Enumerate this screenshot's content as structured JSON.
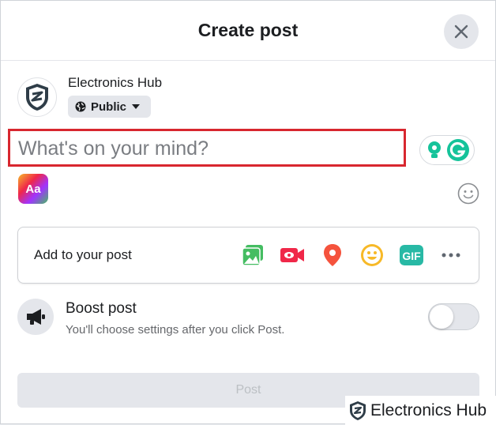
{
  "header": {
    "title": "Create post",
    "close_icon": "close-icon"
  },
  "profile": {
    "name": "Electronics Hub",
    "privacy": "Public",
    "privacy_icon": "globe-icon"
  },
  "composer": {
    "placeholder": "What's on your mind?",
    "value": "",
    "highlight_color": "#d8272f"
  },
  "extras": {
    "background_button": "Aa",
    "emoji_icon": "smiley-icon"
  },
  "add_to_post": {
    "label": "Add to your post",
    "items": [
      {
        "icon": "photo-video-icon",
        "color": "#45bd62"
      },
      {
        "icon": "live-video-icon",
        "color": "#f02849"
      },
      {
        "icon": "location-pin-icon",
        "color": "#f5533d"
      },
      {
        "icon": "feeling-icon",
        "color": "#f7b928"
      },
      {
        "icon": "gif-icon",
        "label": "GIF",
        "color": "#28b9a5"
      },
      {
        "icon": "more-icon",
        "color": "#606770"
      }
    ]
  },
  "boost": {
    "title": "Boost post",
    "subtitle": "You'll choose settings after you click Post.",
    "enabled": false
  },
  "footer": {
    "post_label": "Post"
  },
  "watermark": {
    "text": "Electronics Hub"
  }
}
